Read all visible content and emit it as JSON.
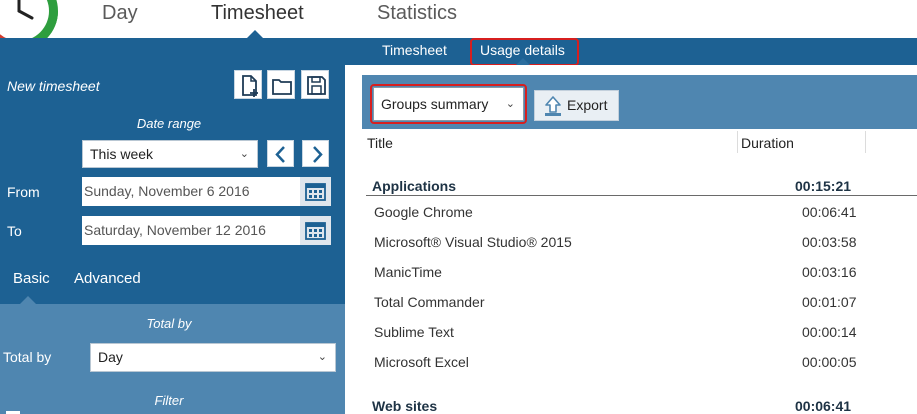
{
  "colors": {
    "primary": "#1d6193",
    "secondary": "#4f86b0",
    "highlight": "#d71f1f",
    "group_text": "#1e3345"
  },
  "topnav": {
    "tabs": [
      {
        "label": "Day"
      },
      {
        "label": "Timesheet"
      },
      {
        "label": "Statistics"
      }
    ],
    "active": "Timesheet"
  },
  "subnav": {
    "tabs": [
      {
        "label": "Timesheet"
      },
      {
        "label": "Usage details"
      }
    ],
    "active": "Usage details"
  },
  "sidebar": {
    "title": "New timesheet",
    "icons": [
      "new-document-icon",
      "folder-icon",
      "save-icon"
    ],
    "date_range_label": "Date range",
    "range_value": "This week",
    "from_label": "From",
    "from_value": "Sunday, November 6 2016",
    "to_label": "To",
    "to_value": "Saturday, November 12 2016",
    "tabs": [
      {
        "label": "Basic"
      },
      {
        "label": "Advanced"
      }
    ],
    "active_tab": "Basic",
    "total_by_heading": "Total by",
    "total_by_label": "Total by",
    "total_by_value": "Day",
    "filter_heading": "Filter"
  },
  "toolbar": {
    "view_value": "Groups summary",
    "export_label": "Export"
  },
  "table": {
    "columns": [
      "Title",
      "Duration"
    ],
    "groups": [
      {
        "title": "Applications",
        "duration": "00:15:21",
        "rows": [
          {
            "title": "Google Chrome",
            "duration": "00:06:41"
          },
          {
            "title": "Microsoft® Visual Studio® 2015",
            "duration": "00:03:58"
          },
          {
            "title": "ManicTime",
            "duration": "00:03:16"
          },
          {
            "title": "Total Commander",
            "duration": "00:01:07"
          },
          {
            "title": "Sublime Text",
            "duration": "00:00:14"
          },
          {
            "title": "Microsoft Excel",
            "duration": "00:00:05"
          }
        ]
      },
      {
        "title": "Web sites",
        "duration": "00:06:41",
        "rows": []
      }
    ]
  }
}
